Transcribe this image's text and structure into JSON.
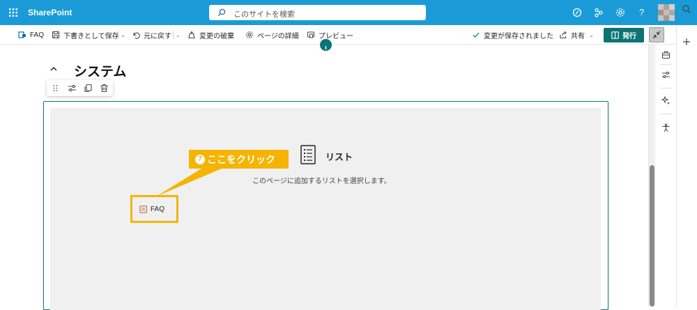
{
  "suite": {
    "app_name": "SharePoint",
    "search_placeholder": "このサイトを検索",
    "help_label": "?"
  },
  "commandbar": {
    "faq_label": "FAQ",
    "save_draft_label": "下書きとして保存",
    "undo_label": "元に戻す",
    "discard_label": "変更の破棄",
    "page_details_label": "ページの詳細",
    "preview_label": "プレビュー",
    "saved_status": "変更が保存されました",
    "share_label": "共有",
    "publish_label": "発行"
  },
  "section": {
    "title": "システム"
  },
  "webpart": {
    "title": "リスト",
    "description": "このページに追加するリストを選択します。",
    "list_items": [
      "FAQ"
    ]
  },
  "callout": {
    "step_number": "7",
    "text": "ここをクリック"
  },
  "colors": {
    "suitebar": "#1a9bd7",
    "accent_teal": "#0b7474",
    "callout_yellow": "#f5b400"
  }
}
